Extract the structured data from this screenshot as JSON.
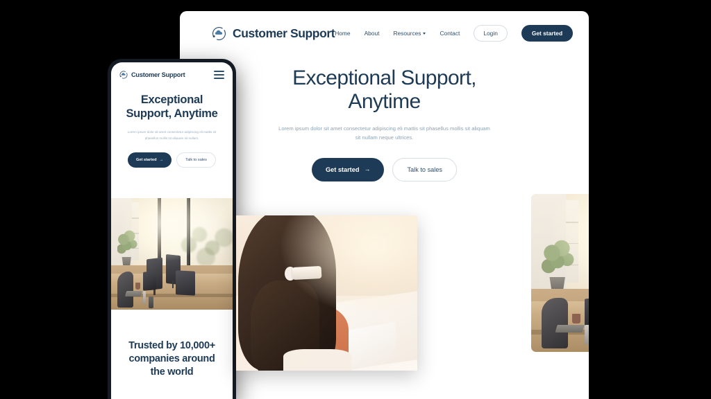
{
  "background_color": "#000000",
  "brand": {
    "name": "Customer Support",
    "logo_icon": "cloud-orbit-icon",
    "primary_color": "#1d3a56",
    "text_muted_color": "#8fa3b5"
  },
  "desktop": {
    "nav": {
      "links": [
        {
          "label": "Home",
          "has_dropdown": false
        },
        {
          "label": "About",
          "has_dropdown": false
        },
        {
          "label": "Resources",
          "has_dropdown": true
        },
        {
          "label": "Contact",
          "has_dropdown": false
        }
      ],
      "login_label": "Login",
      "get_started_label": "Get started"
    },
    "hero": {
      "heading_line1": "Exceptional Support,",
      "heading_line2": "Anytime",
      "subtext": "Lorem ipsum dolor sit amet consectetur adipiscing eli mattis sit phasellus mollis sit aliquam sit nullam neque ultrices.",
      "primary_cta": "Get started",
      "primary_cta_icon": "arrow-right-icon",
      "secondary_cta": "Talk to sales",
      "photo_alt": "office-support-agent-photo"
    }
  },
  "mobile": {
    "nav": {
      "menu_icon": "hamburger-menu-icon"
    },
    "hero": {
      "heading_line1": "Exceptional",
      "heading_line2": "Support, Anytime",
      "subtext": "Lorem ipsum dolor sit amet consectetur adipiscing eli mattis sit phasellus mollis sit aliquam sit nullam.",
      "primary_cta": "Get started",
      "primary_cta_icon": "arrow-right-icon",
      "secondary_cta": "Talk to sales",
      "photo_alt": "office-desks-photo"
    },
    "trusted": {
      "heading": "Trusted by 10,000+ companies around the world"
    }
  },
  "foreground_photo": {
    "alt": "woman-with-headset-photo"
  },
  "icons": {
    "arrow_right": "→"
  }
}
